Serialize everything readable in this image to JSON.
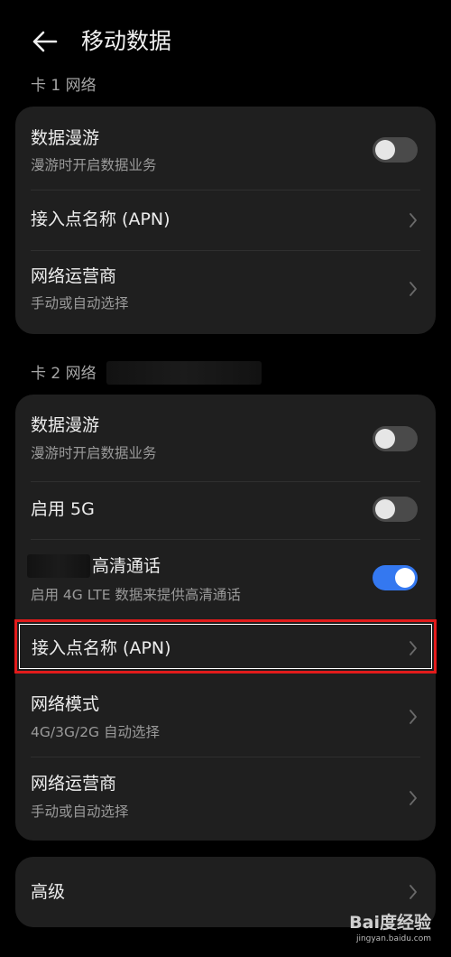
{
  "header": {
    "title": "移动数据",
    "back_icon": "arrow-left-icon"
  },
  "sim1": {
    "label": "卡 1 网络",
    "rows": [
      {
        "title": "数据漫游",
        "subtitle": "漫游时开启数据业务",
        "control": "toggle",
        "on": false
      },
      {
        "title": "接入点名称 (APN)",
        "control": "chevron"
      },
      {
        "title": "网络运营商",
        "subtitle": "手动或自动选择",
        "control": "chevron"
      }
    ]
  },
  "sim2": {
    "label": "卡 2 网络",
    "rows": [
      {
        "title": "数据漫游",
        "subtitle": "漫游时开启数据业务",
        "control": "toggle",
        "on": false
      },
      {
        "title": "启用 5G",
        "control": "toggle",
        "on": false
      },
      {
        "title": "高清通话",
        "subtitle": "启用 4G LTE 数据来提供高清通话",
        "control": "toggle",
        "on": true
      },
      {
        "title": "接入点名称 (APN)",
        "control": "chevron"
      },
      {
        "title": "网络模式",
        "subtitle": "4G/3G/2G 自动选择",
        "control": "chevron"
      },
      {
        "title": "网络运营商",
        "subtitle": "手动或自动选择",
        "control": "chevron"
      }
    ]
  },
  "advanced": {
    "title": "高级"
  },
  "colors": {
    "accent": "#3478f0",
    "highlight": "#e21b1b",
    "card": "#1f1f1f"
  },
  "watermark": {
    "logo": "Bai度经验",
    "url": "jingyan.baidu.com"
  }
}
